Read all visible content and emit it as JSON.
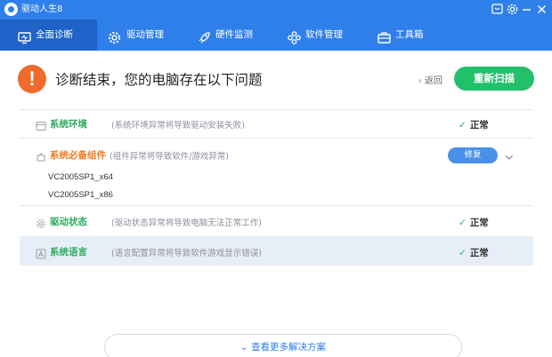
{
  "window": {
    "title": "驱动人生8",
    "controls": [
      "message-icon",
      "gear-icon",
      "minimize-icon",
      "close-icon"
    ]
  },
  "nav": {
    "tabs": [
      {
        "label": "全面诊断",
        "icon": "monitor-icon",
        "active": true
      },
      {
        "label": "驱动管理",
        "icon": "gear-icon",
        "active": false
      },
      {
        "label": "硬件监测",
        "icon": "rocket-icon",
        "active": false
      },
      {
        "label": "软件管理",
        "icon": "apps-icon",
        "active": false
      },
      {
        "label": "工具箱",
        "icon": "toolbox-icon",
        "active": false
      }
    ]
  },
  "header": {
    "alert_symbol": "!",
    "title": "诊断结束，您的电脑存在以下问题",
    "back_label": "返回",
    "rescan_label": "重新扫描"
  },
  "diagnostics": [
    {
      "name": "系统环境",
      "description": "(系统环境异常将导致驱动安装失败)",
      "status": "正常",
      "color": "#2cab5d"
    },
    {
      "name": "系统必备组件",
      "description": "(组件异常将导致软件/游戏异常)",
      "action": "修复",
      "color": "#f07a1e",
      "components": [
        "VC2005SP1_x64",
        "VC2005SP1_x86"
      ]
    },
    {
      "name": "驱动状态",
      "description": "(驱动状态异常将导致电脑无法正常工作)",
      "status": "正常",
      "color": "#2cab5d"
    },
    {
      "name": "系统语言",
      "description": "(语言配置异常将导致软件游戏显示错误)",
      "status": "正常",
      "color": "#2cab5d"
    }
  ],
  "footer": {
    "more_label": "查看更多解决方案"
  },
  "colors": {
    "primary": "#2f7fea",
    "active_tab": "#1f63c8",
    "ok": "#22b566",
    "warning": "#f06a2e",
    "rescan": "#22c06a",
    "selected_row": "#e8eef8"
  }
}
